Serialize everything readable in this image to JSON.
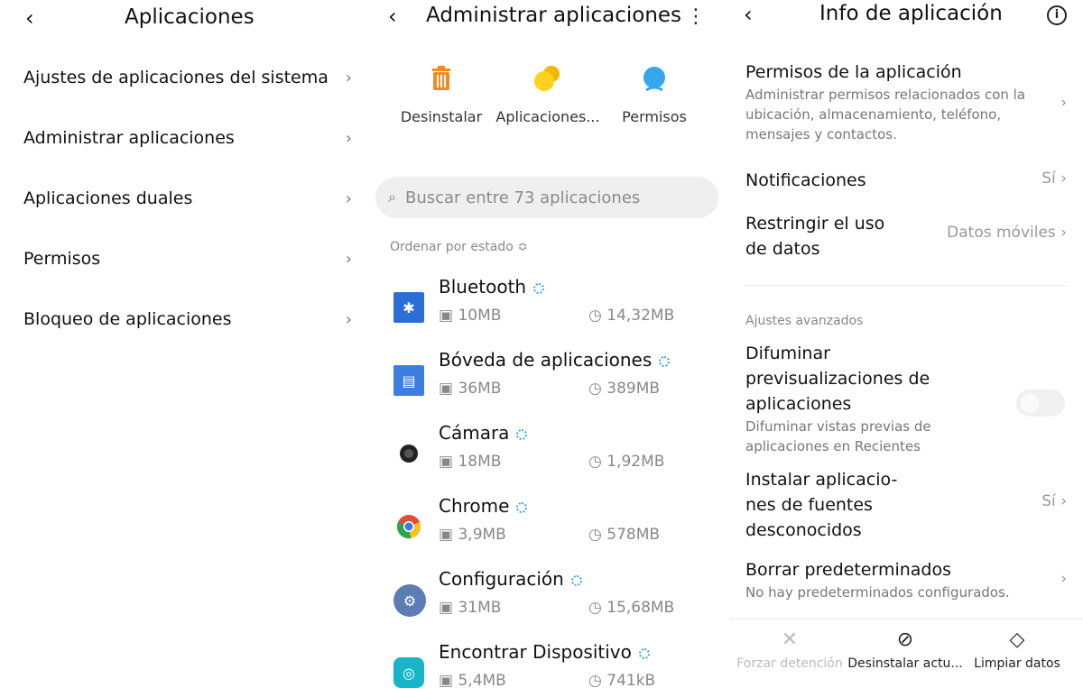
{
  "panel1": {
    "title": "Aplicaciones",
    "items": [
      {
        "label": "Ajustes de aplicaciones del sistema"
      },
      {
        "label": "Administrar aplicaciones"
      },
      {
        "label": "Aplicaciones duales"
      },
      {
        "label": "Permisos"
      },
      {
        "label": "Bloqueo de aplicaciones"
      }
    ]
  },
  "panel2": {
    "title": "Administrar aplicaciones",
    "actions": [
      {
        "label": "Desinstalar",
        "icon": "trash-icon"
      },
      {
        "label": "Aplicaciones...",
        "icon": "dual-apps-icon"
      },
      {
        "label": "Permisos",
        "icon": "permissions-icon"
      }
    ],
    "search_placeholder": "Buscar entre 73 aplicaciones",
    "sort_label": "Ordenar por estado ≎",
    "apps": [
      {
        "name": "Bluetooth",
        "app_size": "10MB",
        "data_size": "14,32MB",
        "color": "#2b6fd6"
      },
      {
        "name": "Bóveda de aplicaciones",
        "app_size": "36MB",
        "data_size": "389MB",
        "color": "#3b7ee0"
      },
      {
        "name": "Cámara",
        "app_size": "18MB",
        "data_size": "1,92MB",
        "color": "#222222"
      },
      {
        "name": "Chrome",
        "app_size": "3,9MB",
        "data_size": "578MB",
        "color": "#e24c3c"
      },
      {
        "name": "Configuración",
        "app_size": "31MB",
        "data_size": "15,68MB",
        "color": "#5b7db3"
      },
      {
        "name": "Encontrar Dispositivo",
        "app_size": "5,4MB",
        "data_size": "741kB",
        "color": "#18b5c9"
      }
    ]
  },
  "panel3": {
    "title": "Info de aplicación",
    "permissions": {
      "title": "Permisos de la aplicación",
      "desc": "Administrar permisos relacionados con la ubicación, almacenamiento, teléfono, mensajes y contactos."
    },
    "notifications": {
      "title": "Notificaciones",
      "value": "Sí"
    },
    "data_usage": {
      "title": "Restringir el uso de datos",
      "value": "Datos móviles"
    },
    "section_advanced": "Ajustes avanzados",
    "blur": {
      "title": "Difuminar previsualizaciones de aplicaciones",
      "desc": "Difuminar vistas previas de aplicaciones en Recientes"
    },
    "unknown_sources": {
      "title": "Instalar aplicacio- nes de fuentes desconocidos",
      "value": "Sí"
    },
    "defaults": {
      "title": "Borrar predeterminados",
      "desc": "No hay predeterminados configurados."
    },
    "bottom": [
      {
        "label": "Forzar detención",
        "icon": "close-icon"
      },
      {
        "label": "Desinstalar actu...",
        "icon": "block-icon"
      },
      {
        "label": "Limpiar datos",
        "icon": "eraser-icon"
      }
    ]
  }
}
